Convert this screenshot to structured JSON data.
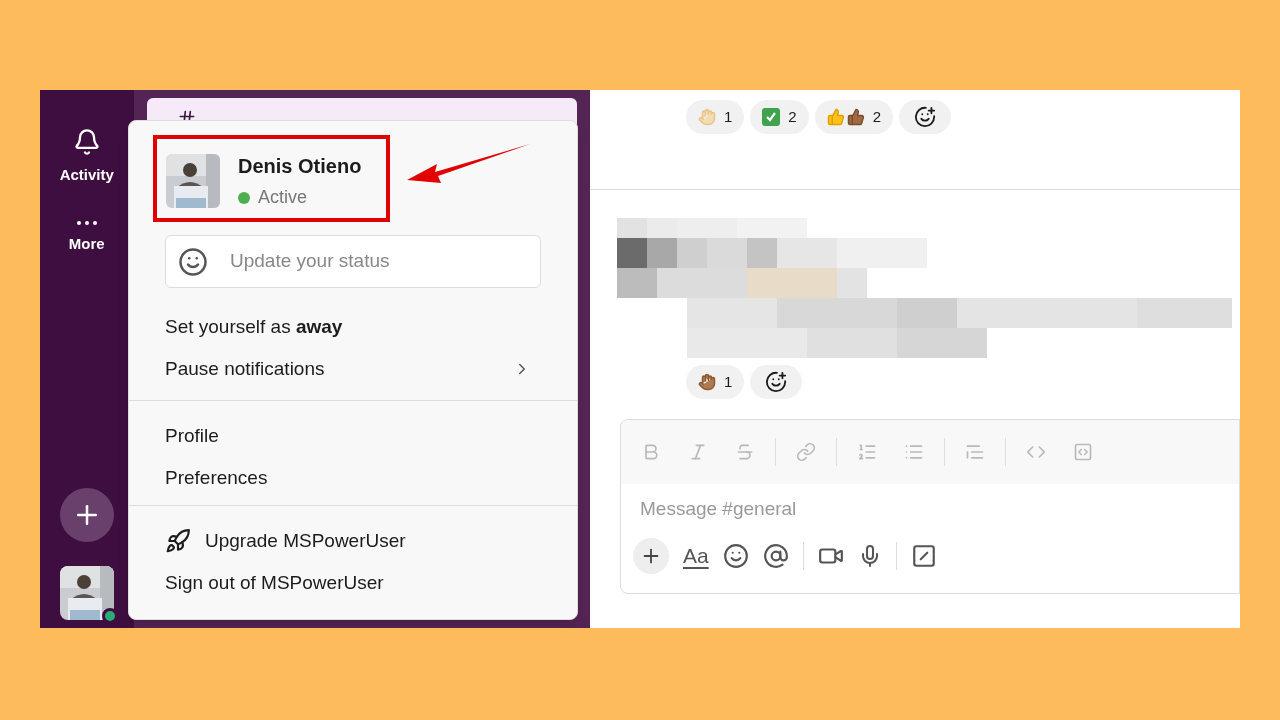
{
  "rail": {
    "items": [
      {
        "kind": "activity",
        "label": "Activity"
      },
      {
        "kind": "more",
        "label": "More"
      }
    ],
    "user_online": true
  },
  "popup": {
    "user": {
      "name": "Denis Otieno",
      "status": "Active",
      "online": true
    },
    "status_field": {
      "placeholder": "Update your status"
    },
    "sections": [
      [
        {
          "kind": "plain",
          "text": "Set yourself as **away**"
        },
        {
          "kind": "submenu",
          "text": "Pause notifications"
        }
      ],
      [
        {
          "kind": "plain",
          "text": "Profile"
        },
        {
          "kind": "plain",
          "text": "Preferences"
        }
      ],
      [
        {
          "kind": "upgrade",
          "text": "Upgrade MSPowerUser"
        },
        {
          "kind": "plain",
          "text": "Sign out of MSPowerUser"
        }
      ]
    ]
  },
  "messages": {
    "reaction_rows": [
      [
        {
          "kind": "raised-hands",
          "count": "1"
        },
        {
          "kind": "check",
          "count": "2"
        },
        {
          "kind": "thumbs",
          "count": "2"
        }
      ],
      [
        {
          "kind": "raised-hands-dark",
          "count": "1"
        }
      ]
    ],
    "blurred": {
      "kind": "picture"
    }
  },
  "composer": {
    "placeholder": "Message #general",
    "format_label": "Aa"
  }
}
